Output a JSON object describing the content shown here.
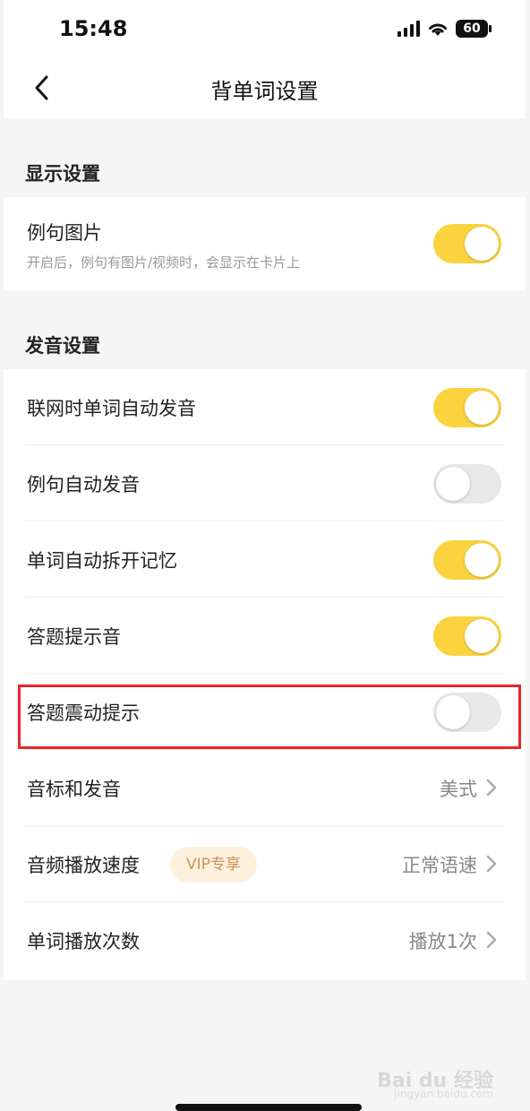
{
  "status_bar": {
    "time": "15:48",
    "battery": "60"
  },
  "nav": {
    "title": "背单词设置"
  },
  "display_section": {
    "header": "显示设置",
    "items": [
      {
        "label": "例句图片",
        "sub": "开启后，例句有图片/视频时，会显示在卡片上",
        "state": "on"
      }
    ]
  },
  "audio_section": {
    "header": "发音设置",
    "toggles": [
      {
        "label": "联网时单词自动发音",
        "state": "on"
      },
      {
        "label": "例句自动发音",
        "state": "off"
      },
      {
        "label": "单词自动拆开记忆",
        "state": "on"
      },
      {
        "label": "答题提示音",
        "state": "on"
      },
      {
        "label": "答题震动提示",
        "state": "off"
      }
    ],
    "options": [
      {
        "label": "音标和发音",
        "value": "美式",
        "badge": ""
      },
      {
        "label": "音频播放速度",
        "value": "正常语速",
        "badge": "VIP专享"
      },
      {
        "label": "单词播放次数",
        "value": "播放1次",
        "badge": ""
      }
    ]
  },
  "watermark": {
    "main": "Bai du 经验",
    "sub": "jingyan.baidu.com"
  },
  "colors": {
    "toggle_on": "#fbd33f",
    "toggle_off": "#e8e8e8",
    "highlight": "#e8262a",
    "vip_bg": "#fdf0dc",
    "vip_text": "#c8965a"
  }
}
